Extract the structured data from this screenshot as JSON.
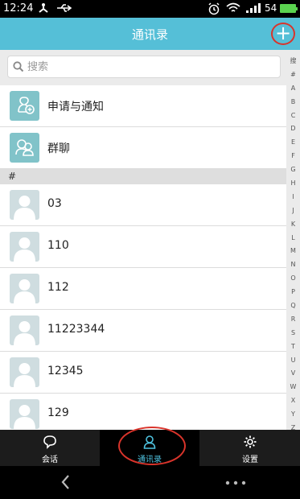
{
  "status_bar": {
    "time": "12:24",
    "battery": "54",
    "accent_color": "#5bd34f"
  },
  "header": {
    "title": "通讯录",
    "add_label": "+",
    "background": "#55bfd7"
  },
  "search": {
    "placeholder": "搜索"
  },
  "special_items": [
    {
      "label": "申请与通知",
      "icon": "notification-avatar-icon"
    },
    {
      "label": "群聊",
      "icon": "group-chat-icon"
    }
  ],
  "section_header": "#",
  "contacts": [
    {
      "name": "03"
    },
    {
      "name": "110"
    },
    {
      "name": "112"
    },
    {
      "name": "11223344"
    },
    {
      "name": "12345"
    },
    {
      "name": "129"
    }
  ],
  "index_letters": [
    "搜",
    "#",
    "A",
    "B",
    "C",
    "D",
    "E",
    "F",
    "G",
    "H",
    "I",
    "J",
    "K",
    "L",
    "M",
    "N",
    "O",
    "P",
    "Q",
    "R",
    "S",
    "T",
    "U",
    "V",
    "W",
    "X",
    "Y",
    "Z"
  ],
  "tabs": [
    {
      "label": "会话",
      "icon": "chat-bubble-icon",
      "active": false
    },
    {
      "label": "通讯录",
      "icon": "person-icon",
      "active": true
    },
    {
      "label": "设置",
      "icon": "gear-icon",
      "active": false
    }
  ],
  "nav": {
    "back_icon": "back-chevron-icon",
    "more_icon": "more-dots-icon"
  }
}
